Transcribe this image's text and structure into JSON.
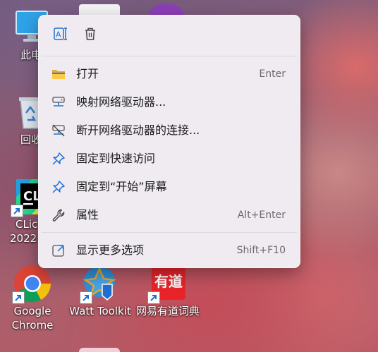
{
  "desktop_icons": [
    {
      "id": "this-pc",
      "label": "此电"
    },
    {
      "id": "recycle-bin",
      "label": "回收"
    },
    {
      "id": "clion",
      "label_line1": "CLic",
      "label_line2": "2022."
    },
    {
      "id": "chrome",
      "label_line1": "Google",
      "label_line2": "Chrome"
    },
    {
      "id": "watt-toolkit",
      "label": "Watt Toolkit"
    },
    {
      "id": "youdao",
      "label": "网易有道词典",
      "badge": "有道"
    }
  ],
  "context_menu": {
    "top_actions": [
      {
        "icon": "rename-icon"
      },
      {
        "icon": "delete-icon"
      }
    ],
    "items": [
      {
        "label": "打开",
        "shortcut": "Enter",
        "icon": "folder-icon"
      },
      {
        "label": "映射网络驱动器...",
        "shortcut": "",
        "icon": "map-network-drive-icon"
      },
      {
        "label": "断开网络驱动器的连接...",
        "shortcut": "",
        "icon": "disconnect-network-drive-icon"
      },
      {
        "label": "固定到快速访问",
        "shortcut": "",
        "icon": "pin-icon"
      },
      {
        "label": "固定到“开始”屏幕",
        "shortcut": "",
        "icon": "pin-icon"
      },
      {
        "label": "属性",
        "shortcut": "Alt+Enter",
        "icon": "wrench-icon"
      }
    ],
    "more_options": {
      "label": "显示更多选项",
      "shortcut": "Shift+F10",
      "icon": "more-options-icon"
    }
  },
  "colors": {
    "accent_blue": "#1f6fd1",
    "menu_bg": "#efebf1"
  }
}
